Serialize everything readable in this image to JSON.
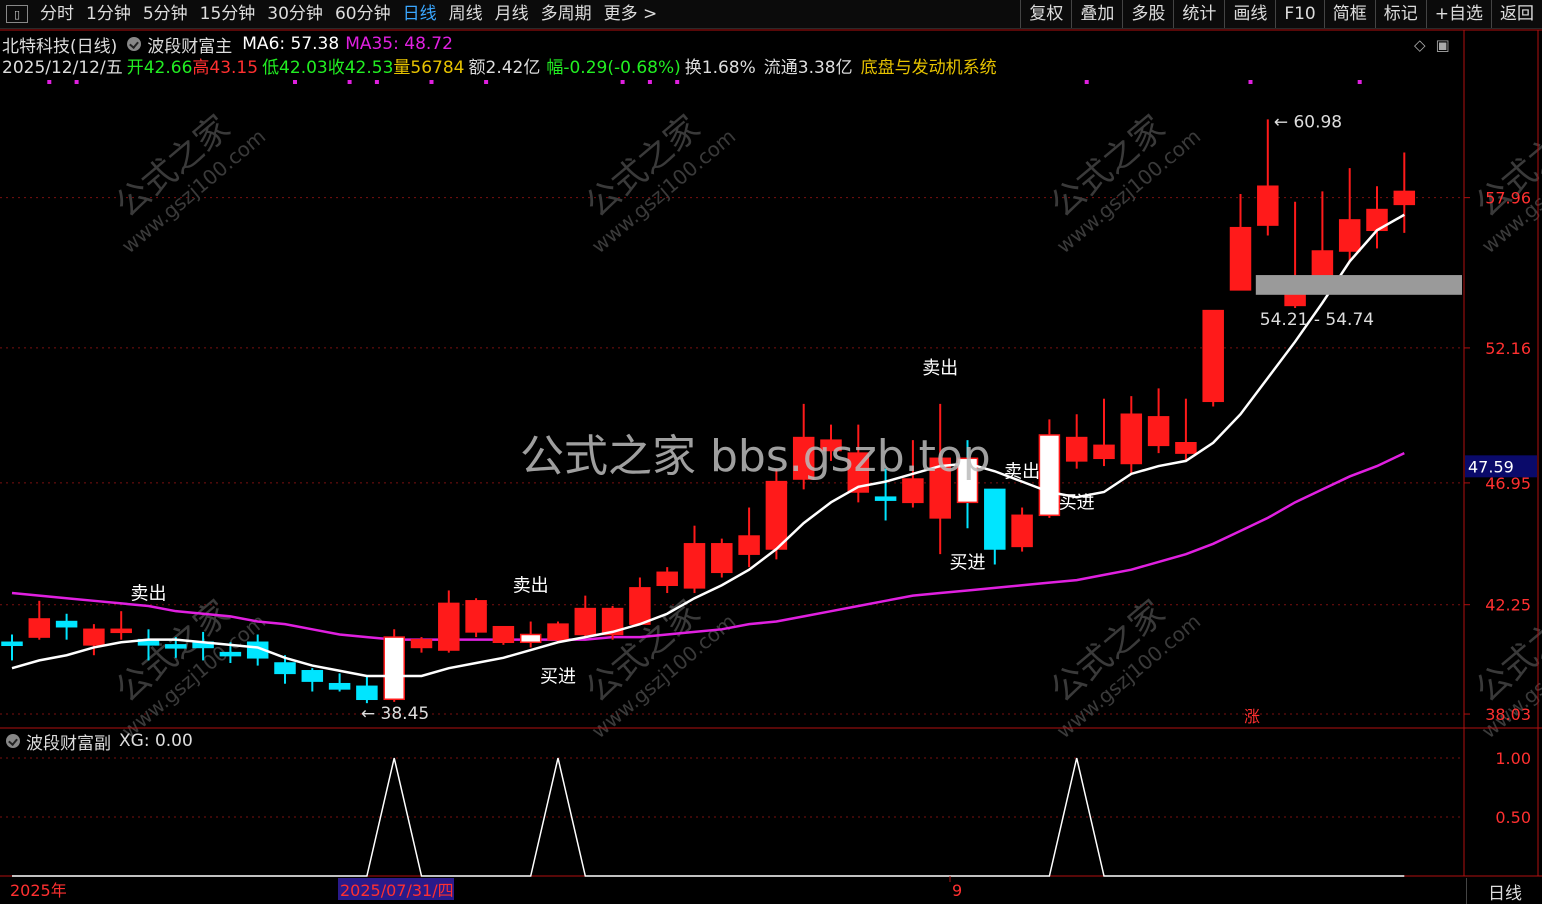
{
  "toolbar": {
    "menu_icon": "menu-square-icon",
    "tabs": [
      "分时",
      "1分钟",
      "5分钟",
      "15分钟",
      "30分钟",
      "60分钟",
      "日线",
      "周线",
      "月线",
      "多周期",
      "更多 >"
    ],
    "active_tab": "日线",
    "right_buttons": [
      "复权",
      "叠加",
      "多股",
      "统计",
      "画线",
      "F10",
      "简框",
      "标记",
      "+自选",
      "返回"
    ]
  },
  "stock": {
    "name": "北特科技(日线)",
    "indicator": "波段财富主",
    "ma6": "MA6: 57.38",
    "ma35": "MA35: 48.72",
    "date": "2025/12/12/五",
    "open": "开42.66",
    "high": "高43.15",
    "low": "低42.03",
    "close": "收42.53",
    "vol": "量56784",
    "amount": "额2.42亿",
    "change": "幅-0.29(-0.68%)",
    "turnover": "换1.68%",
    "float": "流通3.38亿",
    "concept": "底盘与发动机系统"
  },
  "subchart": {
    "title": "波段财富副",
    "xg": "XG: 0.00"
  },
  "watermark": "公式之家 bbs.gszb.top",
  "diag_watermark": "公式之家 www.gszj100.com",
  "bottom_right": "日线",
  "zhang_label": "涨",
  "colors": {
    "up": "#ff1a1a",
    "down": "#00e5ff",
    "ma_short": "#ffffff",
    "ma_long": "#e020e0",
    "grid": "#7a1010",
    "axis": "#b01010",
    "yellow": "#e6c200",
    "green": "#22ee22"
  },
  "chart_data": [
    {
      "type": "candlestick",
      "y_ticks": [
        "57.96",
        "52.16",
        "46.95",
        "42.25",
        "38.03"
      ],
      "ylim": [
        37.8,
        62.5
      ],
      "current_price_tag": "47.59",
      "x_labels": [
        "2025年",
        "2025/07/31/四",
        "9"
      ],
      "annotations": {
        "high": "60.98",
        "low": "38.45",
        "band": "54.21 - 54.74",
        "signals": [
          {
            "text": "卖出",
            "i": 5
          },
          {
            "text": "卖出",
            "i": 19
          },
          {
            "text": "卖出",
            "i": 34
          },
          {
            "text": "卖出",
            "i": 37
          },
          {
            "text": "买进",
            "i": 20
          },
          {
            "text": "买进",
            "i": 35
          },
          {
            "text": "买进",
            "i": 39
          }
        ]
      },
      "candles": [
        [
          40.8,
          40.7,
          41.1,
          40.1
        ],
        [
          41.0,
          41.7,
          42.4,
          40.9
        ],
        [
          41.6,
          41.4,
          41.9,
          40.9
        ],
        [
          40.7,
          41.3,
          41.5,
          40.3
        ],
        [
          41.2,
          41.3,
          42.0,
          40.9
        ],
        [
          40.9,
          40.7,
          41.3,
          40.1
        ],
        [
          40.7,
          40.6,
          41.0,
          40.2
        ],
        [
          40.8,
          40.6,
          41.2,
          40.1
        ],
        [
          40.4,
          40.3,
          40.8,
          40.0
        ],
        [
          40.8,
          40.2,
          41.1,
          39.9
        ],
        [
          40.0,
          39.6,
          40.3,
          39.2
        ],
        [
          39.7,
          39.3,
          39.8,
          38.9
        ],
        [
          39.2,
          39.0,
          39.6,
          38.9
        ],
        [
          39.1,
          38.6,
          39.5,
          38.45
        ],
        [
          38.6,
          41.0,
          41.3,
          38.5
        ],
        [
          40.6,
          40.9,
          41.0,
          40.4
        ],
        [
          40.5,
          42.3,
          42.8,
          40.4
        ],
        [
          41.2,
          42.4,
          42.5,
          41.0
        ],
        [
          40.8,
          41.4,
          41.4,
          40.7
        ],
        [
          40.8,
          41.1,
          41.6,
          40.6
        ],
        [
          40.9,
          41.5,
          41.6,
          40.8
        ],
        [
          41.1,
          42.1,
          42.6,
          41.0
        ],
        [
          41.1,
          42.1,
          42.2,
          40.9
        ],
        [
          41.5,
          42.9,
          43.3,
          41.5
        ],
        [
          43.0,
          43.5,
          43.7,
          42.7
        ],
        [
          42.9,
          44.6,
          45.3,
          42.7
        ],
        [
          43.5,
          44.6,
          44.8,
          43.3
        ],
        [
          44.2,
          44.9,
          46.0,
          43.7
        ],
        [
          44.4,
          47.0,
          47.5,
          44.0
        ],
        [
          47.1,
          48.7,
          50.0,
          46.7
        ],
        [
          48.2,
          48.6,
          49.2,
          47.8
        ],
        [
          46.6,
          48.1,
          49.2,
          46.2
        ],
        [
          46.4,
          46.3,
          47.5,
          45.5
        ],
        [
          46.2,
          47.1,
          48.6,
          46.0
        ],
        [
          45.6,
          47.9,
          50.0,
          44.2
        ],
        [
          47.9,
          46.2,
          48.6,
          45.2
        ],
        [
          46.7,
          44.4,
          46.7,
          43.8
        ],
        [
          44.5,
          45.7,
          46.0,
          44.3
        ],
        [
          45.7,
          48.8,
          49.4,
          45.6
        ],
        [
          47.8,
          48.7,
          49.6,
          47.5
        ],
        [
          47.9,
          48.4,
          50.2,
          47.6
        ],
        [
          47.7,
          49.6,
          50.3,
          47.3
        ],
        [
          48.4,
          49.5,
          50.6,
          48.1
        ],
        [
          48.1,
          48.5,
          50.2,
          47.8
        ],
        [
          50.1,
          53.6,
          53.6,
          49.9
        ],
        [
          54.4,
          56.8,
          58.1,
          54.4
        ],
        [
          56.9,
          58.4,
          60.98,
          56.5
        ],
        [
          53.8,
          54.9,
          57.8,
          53.7
        ],
        [
          54.9,
          55.9,
          58.2,
          54.7
        ],
        [
          55.9,
          57.1,
          59.1,
          55.5
        ],
        [
          56.7,
          57.5,
          58.4,
          56.0
        ],
        [
          57.7,
          58.2,
          59.7,
          56.6
        ]
      ],
      "ma6": [
        39.8,
        40.1,
        40.3,
        40.6,
        40.8,
        40.9,
        40.9,
        40.8,
        40.7,
        40.6,
        40.2,
        39.9,
        39.7,
        39.5,
        39.5,
        39.5,
        39.8,
        40.0,
        40.2,
        40.5,
        40.8,
        41.0,
        41.2,
        41.5,
        41.9,
        42.5,
        43.0,
        43.6,
        44.4,
        45.4,
        46.2,
        46.8,
        47.0,
        47.3,
        47.6,
        47.7,
        47.4,
        47.0,
        46.6,
        46.4,
        46.6,
        47.3,
        47.6,
        47.8,
        48.5,
        49.6,
        51.0,
        52.4,
        53.9,
        55.5,
        56.7,
        57.3
      ],
      "ma35": [
        42.7,
        42.6,
        42.5,
        42.4,
        42.3,
        42.2,
        42.0,
        41.9,
        41.8,
        41.6,
        41.5,
        41.3,
        41.1,
        41.0,
        40.9,
        40.9,
        40.9,
        40.9,
        40.9,
        40.9,
        40.9,
        40.9,
        41.0,
        41.0,
        41.1,
        41.2,
        41.3,
        41.5,
        41.6,
        41.8,
        42.0,
        42.2,
        42.4,
        42.6,
        42.7,
        42.8,
        42.9,
        43.0,
        43.1,
        43.2,
        43.4,
        43.6,
        43.9,
        44.2,
        44.6,
        45.1,
        45.6,
        46.2,
        46.7,
        47.2,
        47.6,
        48.1
      ]
    },
    {
      "type": "line",
      "series_name": "XG",
      "y_ticks": [
        "1.00",
        "0.50"
      ],
      "ylim": [
        0,
        1
      ],
      "spikes": [
        14,
        20,
        39
      ]
    }
  ]
}
